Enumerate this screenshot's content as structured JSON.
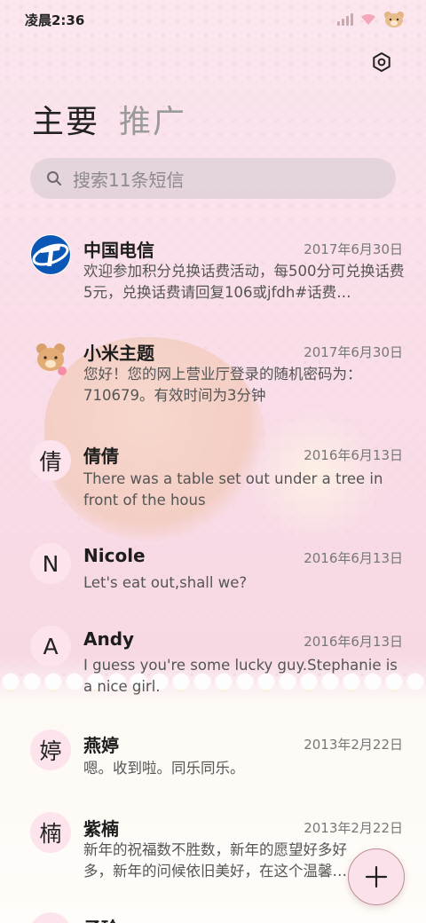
{
  "status_bar": {
    "time": "凌晨2:36"
  },
  "tabs": [
    {
      "label": "主要",
      "active": true
    },
    {
      "label": "推广",
      "active": false
    }
  ],
  "search": {
    "placeholder": "搜索11条短信"
  },
  "conversations": [
    {
      "avatar": "",
      "avatar_type": "telecom-logo",
      "name": "中国电信",
      "date": "2017年6月30日",
      "preview": "欢迎参加积分兑换话费活动，每500分可兑换话费5元，兑换话费请回复106或jfdh#话费…"
    },
    {
      "avatar": "",
      "avatar_type": "bear-image",
      "name": "小米主题",
      "date": "2017年6月30日",
      "preview": "您好！您的网上营业厅登录的随机密码为：710679。有效时间为3分钟"
    },
    {
      "avatar": "倩",
      "avatar_type": "letter",
      "name": "倩倩",
      "date": "2016年6月13日",
      "preview": "There was a table set out under a tree in front of the hous"
    },
    {
      "avatar": "N",
      "avatar_type": "letter",
      "name": "Nicole",
      "date": "2016年6月13日",
      "preview": "Let's eat out,shall we?"
    },
    {
      "avatar": "A",
      "avatar_type": "letter",
      "name": "Andy",
      "date": "2016年6月13日",
      "preview": "I guess you're some lucky guy.Stephanie is a nice girl."
    },
    {
      "avatar": "婷",
      "avatar_type": "letter",
      "name": "燕婷",
      "date": "2013年2月22日",
      "preview": "嗯。收到啦。同乐同乐。"
    },
    {
      "avatar": "楠",
      "avatar_type": "letter",
      "name": "紫楠",
      "date": "2013年2月22日",
      "preview": "新年的祝福数不胜数，新年的愿望好多好多，新年的问候依旧美好，在这个温馨的时刻"
    },
    {
      "avatar": "",
      "avatar_type": "letter",
      "name": "子玲",
      "date": "",
      "preview": ""
    }
  ],
  "icons": {
    "settings": "settings-icon",
    "search": "search-icon",
    "compose": "plus-icon"
  },
  "colors": {
    "accent_pink": "#fbe1ea",
    "avatar_bg": "#fde3ec"
  }
}
